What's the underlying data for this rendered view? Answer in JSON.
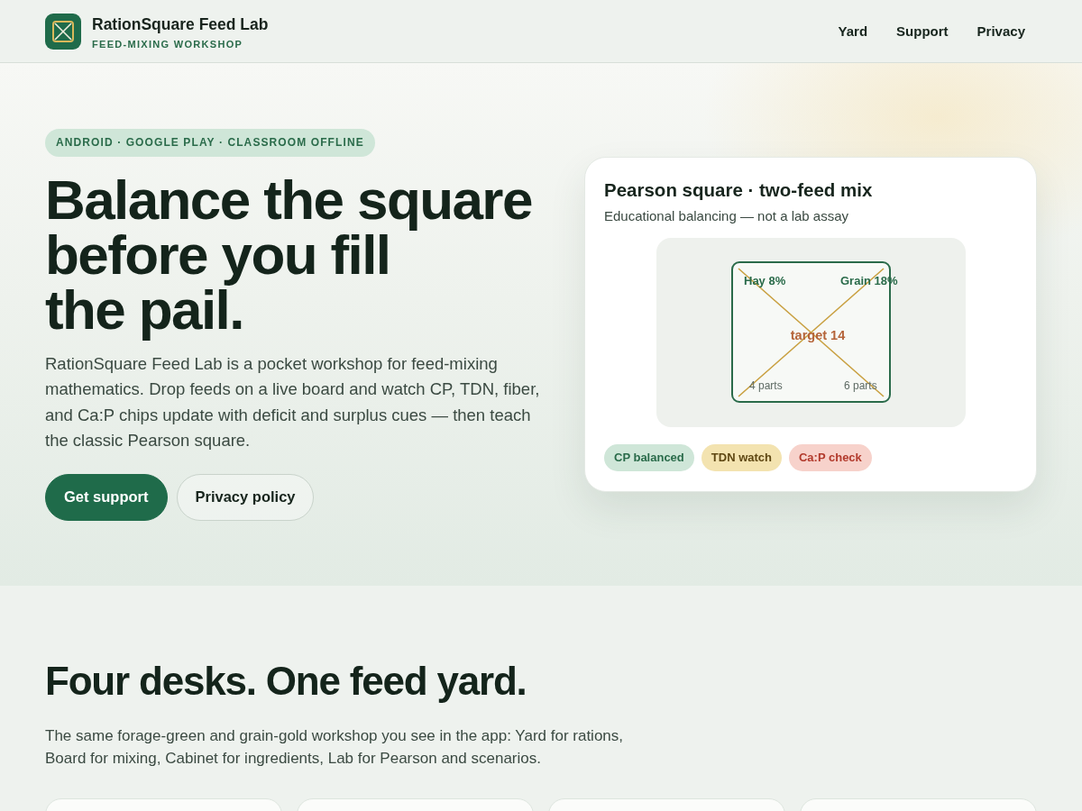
{
  "header": {
    "brand": {
      "name": "RationSquare Feed Lab",
      "tagline": "FEED-MIXING WORKSHOP"
    },
    "nav": [
      "Yard",
      "Support",
      "Privacy"
    ]
  },
  "hero": {
    "badge": "ANDROID · GOOGLE PLAY · CLASSROOM OFFLINE",
    "headline_lines": [
      "Balance the square",
      "before you fill",
      "the pail."
    ],
    "intro": "RationSquare Feed Lab is a pocket workshop for feed-mixing mathematics. Drop feeds on a live board and watch CP, TDN, fiber, and Ca:P chips update with deficit and surplus cues — then teach the classic Pearson square.",
    "buttons": [
      {
        "label": "Get support",
        "kind": "primary"
      },
      {
        "label": "Privacy policy",
        "kind": "secondary"
      }
    ],
    "card": {
      "title": "Pearson square · two-feed mix",
      "subtitle": "Educational balancing — not a lab assay",
      "diagram": {
        "top_left": "Hay 8%",
        "top_right": "Grain 18%",
        "center": "target 14",
        "bottom_left": "4 parts",
        "bottom_right": "6 parts"
      },
      "chips": [
        {
          "label": "CP balanced",
          "kind": "balanced"
        },
        {
          "label": "TDN watch",
          "kind": "watch"
        },
        {
          "label": "Ca:P check",
          "kind": "check"
        }
      ]
    }
  },
  "desks": {
    "title": "Four desks. One feed yard.",
    "intro": "The same forage-green and grain-gold workshop you see in the app: Yard for rations, Board for mixing, Cabinet for ingredients, Lab for Pearson and scenarios."
  }
}
